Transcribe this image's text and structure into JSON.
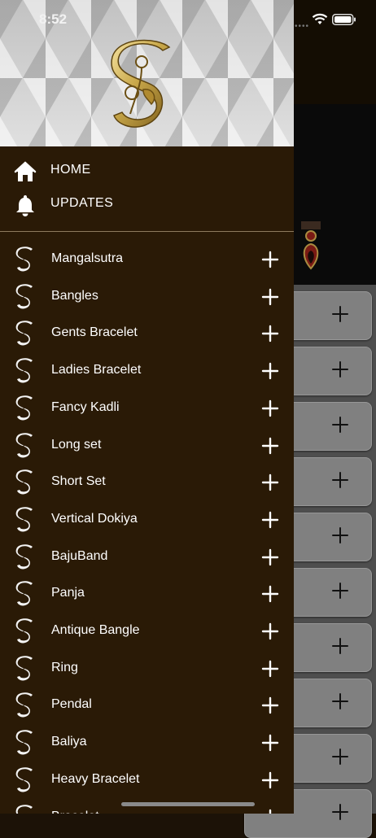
{
  "status_bar": {
    "time": "8:52"
  },
  "drawer": {
    "logo_icon": "s-monogram-logo-icon",
    "nav": [
      {
        "label": "HOME",
        "icon": "home-icon"
      },
      {
        "label": "UPDATES",
        "icon": "bell-icon"
      }
    ],
    "categories": [
      {
        "label": "Mangalsutra"
      },
      {
        "label": "Bangles"
      },
      {
        "label": "Gents Bracelet"
      },
      {
        "label": "Ladies Bracelet"
      },
      {
        "label": "Fancy Kadli"
      },
      {
        "label": "Long set"
      },
      {
        "label": "Short Set"
      },
      {
        "label": "Vertical Dokiya"
      },
      {
        "label": "BajuBand"
      },
      {
        "label": "Panja"
      },
      {
        "label": "Antique Bangle"
      },
      {
        "label": "Ring"
      },
      {
        "label": "Pendal"
      },
      {
        "label": "Baliya"
      },
      {
        "label": "Heavy Bracelet"
      },
      {
        "label": "Bracelet"
      }
    ]
  },
  "colors": {
    "drawer_bg": "#2a1a06",
    "text": "#ffffff",
    "divider": "#8d7a5e",
    "gold": "#c9a84a"
  }
}
